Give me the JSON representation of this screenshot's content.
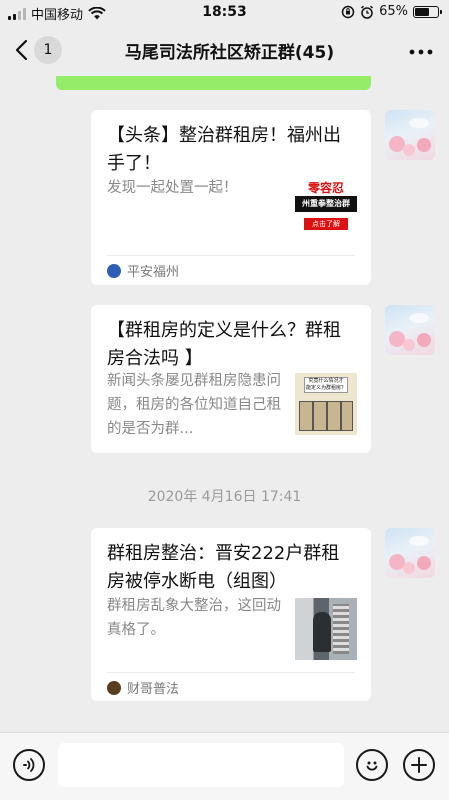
{
  "status_bar": {
    "carrier": "中国移动",
    "time": "18:53",
    "battery": "65%",
    "battery_level": 0.65
  },
  "nav": {
    "back_badge": "1",
    "title": "马尾司法所社区矫正群(45)"
  },
  "messages": [
    {
      "title": "【头条】整治群租房！福州出手了！",
      "desc": "发现一起处置一起！",
      "source": "平安福州",
      "thumb_text": [
        "零容忍",
        "州重拳整治群",
        "点击了解"
      ],
      "source_color": "#2b5fb8"
    },
    {
      "title": "【群租房的定义是什么？群租房合法吗 】",
      "desc": "新闻头条屡见群租房隐患问题，租房的各位知道自己租的是否为群...",
      "source": "",
      "thumb_text": [
        "究竟什么情况才",
        "能定义为群租房？"
      ]
    },
    {
      "title": "群租房整治：晋安222户群租房被停水断电（组图）",
      "desc": "群租房乱象大整治，这回动真格了。",
      "source": "财哥普法",
      "source_color": "#5a3d1e"
    }
  ],
  "timestamp": "2020年 4月16日 17:41",
  "input_bar": {
    "input_value": ""
  }
}
